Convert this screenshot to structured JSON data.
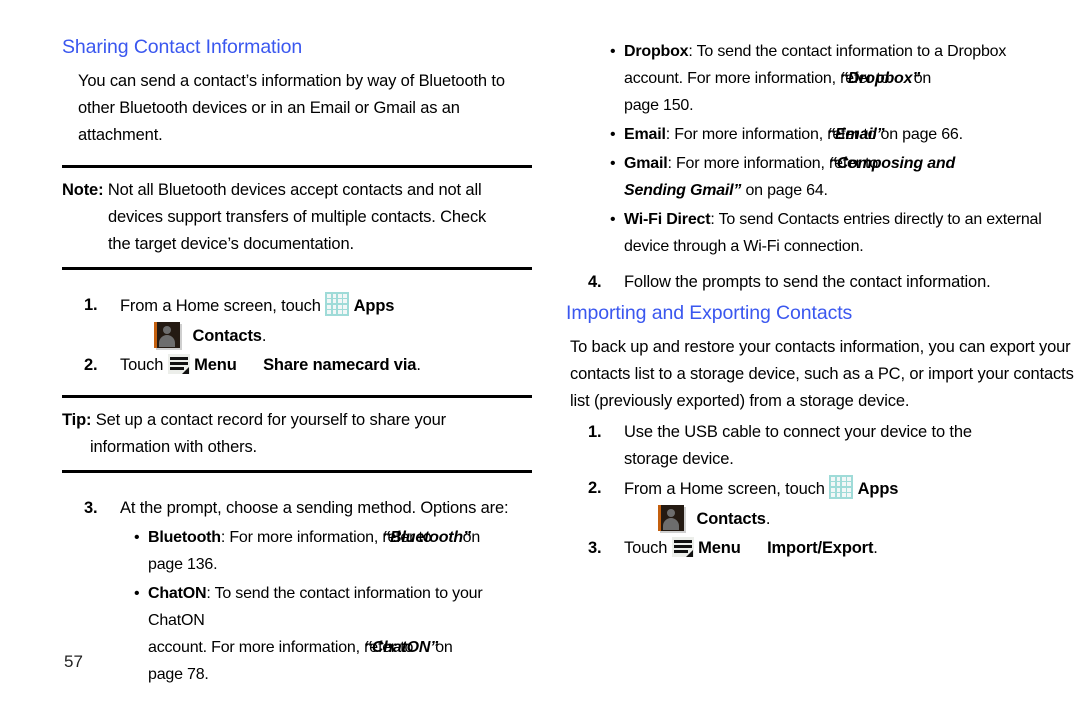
{
  "document": {
    "page_number": "57",
    "heading_color": "#3a57ef"
  },
  "left_column": {
    "heading": "Sharing Contact Information",
    "intro": "You can send a contact’s information by way of Bluetooth to other Bluetooth devices or in an Email or Gmail as an attachment.",
    "note": {
      "label": "Note:",
      "line1": "Not all Bluetooth devices accept contacts and not all",
      "line2": "devices support transfers of multiple contacts. Check",
      "line3": "the target device’s documentation."
    },
    "step1": {
      "number": "1.",
      "text_before_icon": "From a Home screen, touch",
      "apps_label": "Apps",
      "contacts_label": "Contacts",
      "period": "."
    },
    "step2": {
      "number": "2.",
      "text_before_icon": "Touch",
      "menu_label": "Menu",
      "action_label": "Share namecard via",
      "period": "."
    },
    "tip": {
      "label": "Tip:",
      "line1": "Set up a contact record for yourself to share your",
      "line2": "information with others."
    },
    "step3": {
      "number": "3.",
      "text": "At the prompt, choose a sending method. Options are:"
    },
    "options": [
      {
        "term": "Bluetooth",
        "sep": ": ",
        "text": "For more information, ",
        "refer": "refer to",
        "title": "“Bluetooth”",
        "tail": " on",
        "line2": "page 136."
      },
      {
        "term": "ChatON",
        "sep": ": ",
        "text": "To send the contact information to your ChatON",
        "line2_pre": "account. For more information, ",
        "refer": "refer to",
        "title": "“ChatON”",
        "tail": " on",
        "line3": "page 78."
      }
    ]
  },
  "right_column": {
    "options": [
      {
        "term": "Dropbox",
        "sep": ": ",
        "text": "To send the contact information to a Dropbox",
        "line2_pre": "account. For more information, ",
        "refer": "refer to",
        "title": "“Dropbox”",
        "tail": " on",
        "line3": "page 150."
      },
      {
        "term": "Email",
        "sep": ": ",
        "text_pre": "For more information, ",
        "refer": "refer to",
        "title": "“Email”",
        "tail": " on page 66."
      },
      {
        "term": "Gmail",
        "sep": ": ",
        "text_pre": "For more information, ",
        "refer": "refer to",
        "title": "“Composing and",
        "title_line2": "Sending Gmail”",
        "tail": " on page 64."
      },
      {
        "term": "Wi-Fi Direct",
        "sep": ": ",
        "text": "To send Contacts entries directly to an external",
        "line2": "device through a Wi-Fi connection."
      }
    ],
    "step4": {
      "number": "4.",
      "text": "Follow the prompts to send the contact information."
    },
    "heading": "Importing and Exporting Contacts",
    "intro": "To back up and restore your contacts information, you can export your contacts list to a storage device, such as a PC, or import your contacts list (previously exported) from a storage device.",
    "step1": {
      "number": "1.",
      "line1": "Use the USB cable to connect your device to the",
      "line2": "storage device."
    },
    "step2": {
      "number": "2.",
      "text_before_icon": "From a Home screen, touch",
      "apps_label": "Apps",
      "contacts_label": "Contacts",
      "period": "."
    },
    "step3": {
      "number": "3.",
      "text_before_icon": "Touch",
      "menu_label": "Menu",
      "action_label": "Import/Export",
      "period": "."
    }
  },
  "icons": {
    "apps": "apps-grid-icon",
    "contacts": "contacts-person-icon",
    "menu": "menu-hamburger-icon"
  }
}
